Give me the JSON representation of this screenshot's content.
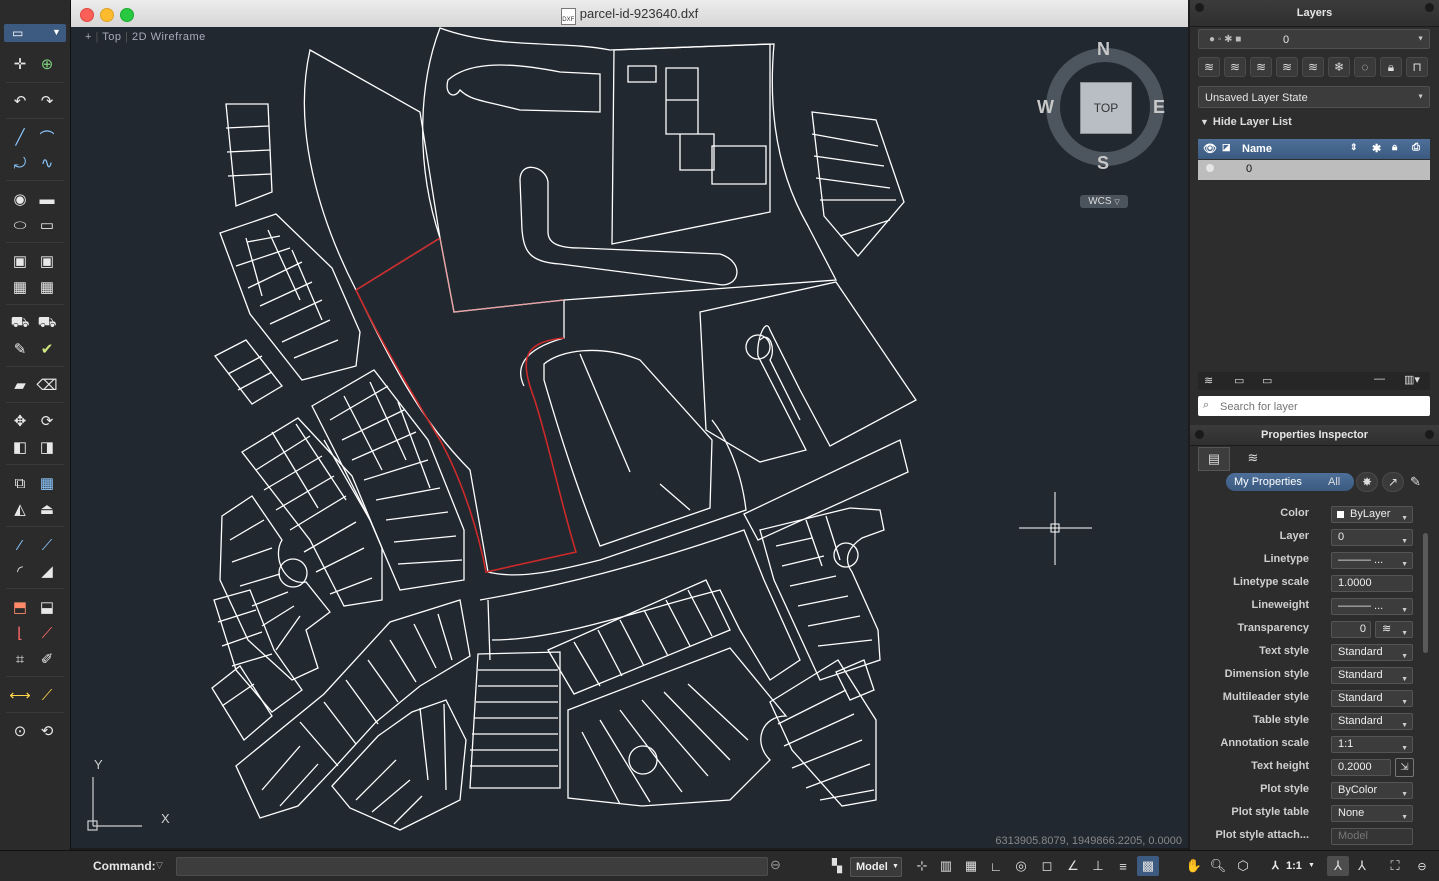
{
  "window": {
    "title": "parcel-id-923640.dxf",
    "file_icon_text": "DXF"
  },
  "viewport": {
    "label_plus": "+",
    "label_view": "Top",
    "label_style": "2D Wireframe",
    "coordinates": "6313905.8079, 1949866.2205, 0.0000",
    "ucs_x": "X",
    "ucs_y": "Y"
  },
  "viewcube": {
    "north": "N",
    "south": "S",
    "east": "E",
    "west": "W",
    "face": "TOP",
    "wcs": "WCS"
  },
  "layers_panel": {
    "title": "Layers",
    "current_layer": "0",
    "layer_state": "Unsaved Layer State",
    "hide_list_label": "Hide Layer List",
    "name_column": "Name",
    "rows": [
      {
        "name": "0"
      }
    ],
    "search_placeholder": "Search for layer"
  },
  "properties": {
    "title": "Properties Inspector",
    "tab_my_properties": "My Properties",
    "tab_all": "All",
    "rows": [
      {
        "label": "Color",
        "value": "ByLayer"
      },
      {
        "label": "Layer",
        "value": "0"
      },
      {
        "label": "Linetype",
        "value": "———  ..."
      },
      {
        "label": "Linetype scale",
        "value": "1.0000"
      },
      {
        "label": "Lineweight",
        "value": "———  ..."
      },
      {
        "label": "Transparency",
        "value": "0"
      },
      {
        "label": "Text style",
        "value": "Standard"
      },
      {
        "label": "Dimension style",
        "value": "Standard"
      },
      {
        "label": "Multileader style",
        "value": "Standard"
      },
      {
        "label": "Table style",
        "value": "Standard"
      },
      {
        "label": "Annotation scale",
        "value": "1:1"
      },
      {
        "label": "Text height",
        "value": "0.2000"
      },
      {
        "label": "Plot style",
        "value": "ByColor"
      },
      {
        "label": "Plot style table",
        "value": "None"
      },
      {
        "label": "Plot style attach...",
        "value": "Model"
      }
    ]
  },
  "command": {
    "label": "Command:",
    "model_label": "Model",
    "scale_label": "1:1"
  },
  "colors": {
    "canvas": "#212830",
    "linework": "#ffffff",
    "highlight": "#cc2a2a",
    "highlight_light": "#e8a0a0"
  }
}
